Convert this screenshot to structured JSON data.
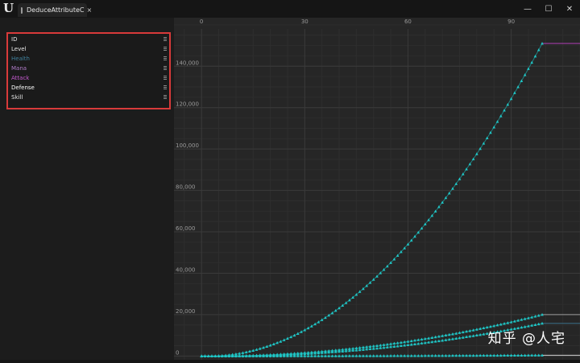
{
  "window": {
    "tab_label": "DeduceAttributeC",
    "tab_close": "×",
    "minimize": "—",
    "maximize": "☐",
    "close": "✕"
  },
  "attributes": [
    {
      "label": "ID",
      "color": "#e8e8e8"
    },
    {
      "label": "Level",
      "color": "#e8e8e8"
    },
    {
      "label": "Health",
      "color": "#3f7f9a"
    },
    {
      "label": "Mana",
      "color": "#b07cc8"
    },
    {
      "label": "Attack",
      "color": "#c65ad0"
    },
    {
      "label": "Defense",
      "color": "#ffffff"
    },
    {
      "label": "Skill",
      "color": "#e8e8e8"
    }
  ],
  "watermark": "知乎 @人宅",
  "chart_data": {
    "type": "line",
    "x_ticks": [
      0,
      30,
      60,
      90
    ],
    "y_ticks": [
      0,
      20000,
      40000,
      60000,
      80000,
      100000,
      120000,
      140000
    ],
    "y_tick_labels": [
      "0",
      "20,000",
      "40,000",
      "60,000",
      "80,000",
      "100,000",
      "120,000",
      "140,000"
    ],
    "xlim": [
      -8,
      110
    ],
    "ylim": [
      -1800,
      158000
    ],
    "series": [
      {
        "key": "main",
        "color": "#1fc7c7",
        "x_start": 0,
        "x_end": 99,
        "values_at": {
          "0": 0,
          "50": 37000,
          "99": 151000
        },
        "tail_color": "#b33fb8"
      },
      {
        "key": "a",
        "color": "#1fc7c7",
        "x_start": 0,
        "x_end": 99,
        "values_at": {
          "0": 0,
          "50": 4800,
          "99": 20000
        },
        "tail_color": "#9a9a9a"
      },
      {
        "key": "b",
        "color": "#1fc7c7",
        "x_start": 0,
        "x_end": 99,
        "values_at": {
          "0": 0,
          "50": 3600,
          "99": 15800
        },
        "tail_color": "#3a6f88"
      },
      {
        "key": "base",
        "color": "#1fc7c7",
        "x_start": 0,
        "x_end": 99,
        "values_at": {
          "0": 0,
          "99": 400
        },
        "tail_color": "#cfcfcf"
      }
    ]
  }
}
